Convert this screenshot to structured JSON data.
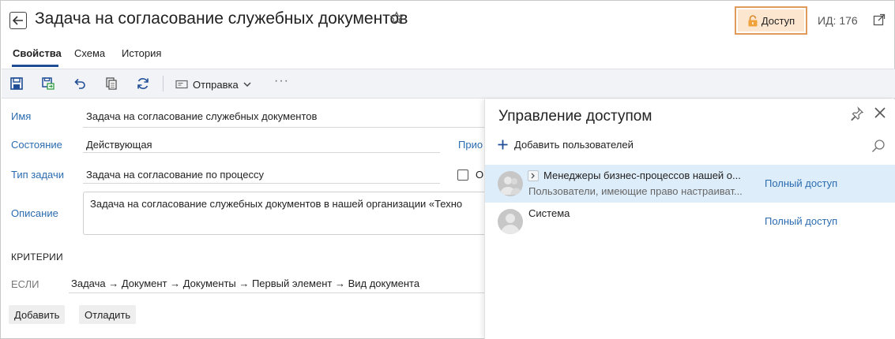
{
  "header": {
    "title": "Задача на согласование служебных документов",
    "access_button": "Доступ",
    "id_label": "ИД: 176"
  },
  "tabs": [
    {
      "label": "Свойства",
      "active": true
    },
    {
      "label": "Схема",
      "active": false
    },
    {
      "label": "История",
      "active": false
    }
  ],
  "toolbar": {
    "send_label": "Отправка",
    "more": "···"
  },
  "form": {
    "name_label": "Имя",
    "name_value": "Задача на согласование служебных документов",
    "state_label": "Состояние",
    "state_value": "Действующая",
    "type_label": "Тип задачи",
    "type_value": "Задача на согласование по процессу",
    "description_label": "Описание",
    "description_value": "Задача на согласование служебных документов в нашей организации «Техно",
    "partial_label": "Прио",
    "checkbox_label": "О"
  },
  "criteria": {
    "title": "КРИТЕРИИ",
    "if_label": "ЕСЛИ",
    "expression": "Задача → Документ → Документы → Первый элемент → Вид документа",
    "add_button": "Добавить",
    "debug_button": "Отладить"
  },
  "access_panel": {
    "title": "Управление доступом",
    "add_users": "Добавить пользователей",
    "entries": [
      {
        "name": "Менеджеры бизнес-процессов нашей о...",
        "description": "Пользователи, имеющие право настраиват...",
        "access": "Полный доступ",
        "selected": true,
        "group": true
      },
      {
        "name": "Система",
        "description": "",
        "access": "Полный доступ",
        "selected": false,
        "group": false
      }
    ]
  },
  "colors": {
    "accent": "#1f4e96",
    "link": "#2b6cb0",
    "access_border": "#e09a5a",
    "access_bg": "#fde6cf",
    "selected_row": "#deedfa"
  }
}
